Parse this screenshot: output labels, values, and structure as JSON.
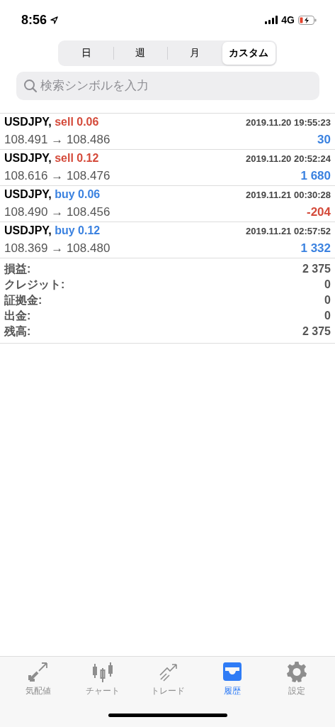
{
  "status_bar": {
    "time": "8:56",
    "network": "4G"
  },
  "period_tabs": [
    {
      "label": "日",
      "selected": false
    },
    {
      "label": "週",
      "selected": false
    },
    {
      "label": "月",
      "selected": false
    },
    {
      "label": "カスタム",
      "selected": true
    }
  ],
  "search": {
    "placeholder": "検索シンボルを入力"
  },
  "deals": [
    {
      "symbol": "USDJPY,",
      "kind": "sell",
      "action": "sell 0.06",
      "time": "2019.11.20 19:55:23",
      "prices": "108.491 → 108.486",
      "profit": "30",
      "loss": false
    },
    {
      "symbol": "USDJPY,",
      "kind": "sell",
      "action": "sell 0.12",
      "time": "2019.11.20 20:52:24",
      "prices": "108.616 → 108.476",
      "profit": "1 680",
      "loss": false
    },
    {
      "symbol": "USDJPY,",
      "kind": "buy",
      "action": "buy 0.06",
      "time": "2019.11.21 00:30:28",
      "prices": "108.490 → 108.456",
      "profit": "-204",
      "loss": true
    },
    {
      "symbol": "USDJPY,",
      "kind": "buy",
      "action": "buy 0.12",
      "time": "2019.11.21 02:57:52",
      "prices": "108.369 → 108.480",
      "profit": "1 332",
      "loss": false
    }
  ],
  "summary": [
    {
      "label": "損益:",
      "value": "2 375"
    },
    {
      "label": "クレジット:",
      "value": "0"
    },
    {
      "label": "証拠金:",
      "value": "0"
    },
    {
      "label": "出金:",
      "value": "0"
    },
    {
      "label": "残高:",
      "value": "2 375"
    }
  ],
  "tab_bar": [
    {
      "kind": "quotes",
      "label": "気配値",
      "selected": false
    },
    {
      "kind": "chart",
      "label": "チャート",
      "selected": false
    },
    {
      "kind": "trade",
      "label": "トレード",
      "selected": false
    },
    {
      "kind": "history",
      "label": "履歴",
      "selected": true
    },
    {
      "kind": "settings",
      "label": "設定",
      "selected": false
    }
  ]
}
